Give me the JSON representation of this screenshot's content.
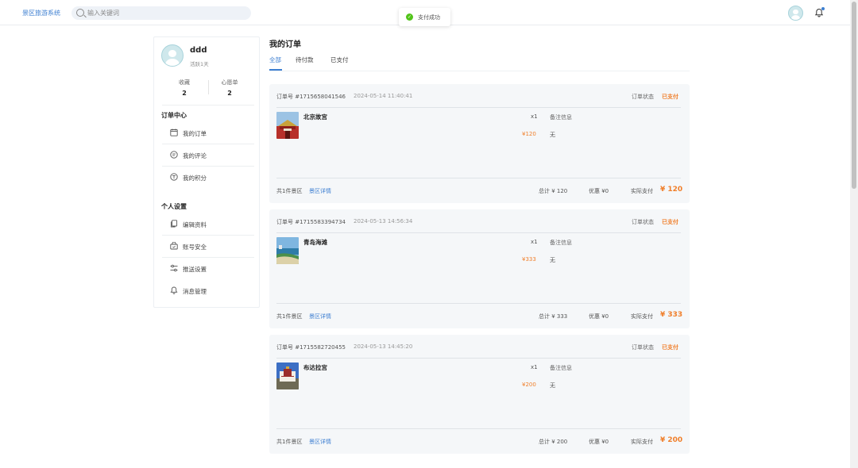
{
  "header": {
    "brand": "景区旅游系统",
    "search_placeholder": "输入关键词",
    "toast": "支付成功"
  },
  "sidebar": {
    "username": "ddd",
    "days": "活跃1天",
    "stats": [
      {
        "label": "收藏",
        "value": "2"
      },
      {
        "label": "心愿单",
        "value": "2"
      }
    ],
    "order_center_title": "订单中心",
    "order_items": [
      {
        "label": "我的订单",
        "icon": "calendar-icon"
      },
      {
        "label": "我的评论",
        "icon": "comment-icon"
      },
      {
        "label": "我的积分",
        "icon": "points-icon"
      }
    ],
    "settings_title": "个人设置",
    "settings_items": [
      {
        "label": "编辑资料",
        "icon": "document-icon"
      },
      {
        "label": "账号安全",
        "icon": "shield-icon"
      },
      {
        "label": "推送设置",
        "icon": "sliders-icon"
      },
      {
        "label": "消息管理",
        "icon": "bell-icon"
      }
    ]
  },
  "main": {
    "title": "我的订单",
    "tabs": [
      "全部",
      "待付款",
      "已支付"
    ],
    "active_tab": 0,
    "orders": [
      {
        "order_no": "订单号 #1715658041546",
        "date": "2024-05-14 11:40:41",
        "status_label": "订单状态",
        "status": "已支付",
        "product": "北京故宫",
        "qty": "x1",
        "price": "¥120",
        "note_label": "备注信息",
        "note": "无",
        "count": "共1件景区",
        "detail_link": "景区详情",
        "total": "总计 ¥ 120",
        "discount": "优惠 ¥0",
        "paid_label": "实际支付",
        "paid": "¥ 120"
      },
      {
        "order_no": "订单号 #1715583394734",
        "date": "2024-05-13 14:56:34",
        "status_label": "订单状态",
        "status": "已支付",
        "product": "青岛海滩",
        "qty": "x1",
        "price": "¥333",
        "note_label": "备注信息",
        "note": "无",
        "count": "共1件景区",
        "detail_link": "景区详情",
        "total": "总计 ¥ 333",
        "discount": "优惠 ¥0",
        "paid_label": "实际支付",
        "paid": "¥ 333"
      },
      {
        "order_no": "订单号 #1715582720455",
        "date": "2024-05-13 14:45:20",
        "status_label": "订单状态",
        "status": "已支付",
        "product": "布达拉宫",
        "qty": "x1",
        "price": "¥200",
        "note_label": "备注信息",
        "note": "无",
        "count": "共1件景区",
        "detail_link": "景区详情",
        "total": "总计 ¥ 200",
        "discount": "优惠 ¥0",
        "paid_label": "实际支付",
        "paid": "¥ 200"
      }
    ]
  },
  "colors": {
    "accent": "#3d7fd1",
    "price": "#f07f2b",
    "success": "#52c41a"
  }
}
